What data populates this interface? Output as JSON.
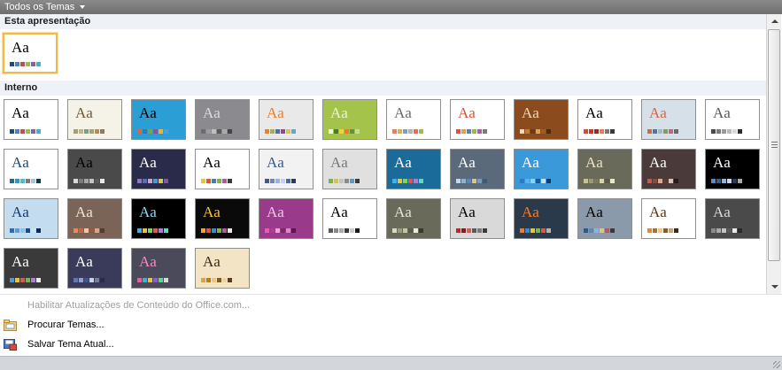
{
  "header": {
    "title": "Todos os Temas"
  },
  "sections": {
    "current": {
      "label": "Esta apresentação"
    },
    "builtin": {
      "label": "Interno"
    }
  },
  "sample_text": "Aa",
  "themes": {
    "current": [
      {
        "bg": "#ffffff",
        "fg": "#000000",
        "sw": [
          "#1f497d",
          "#4f81bd",
          "#c0504d",
          "#9bbb59",
          "#8064a2",
          "#4bacc6"
        ]
      }
    ],
    "builtin": [
      {
        "bg": "#ffffff",
        "fg": "#000000",
        "sw": [
          "#1f497d",
          "#4f81bd",
          "#c0504d",
          "#9bbb59",
          "#8064a2",
          "#4bacc6"
        ]
      },
      {
        "bg": "#f5f2e8",
        "fg": "#6b5a3a",
        "sw": [
          "#a79f72",
          "#c4b48a",
          "#7c9f86",
          "#9fa56e",
          "#b58c58",
          "#8c7c5c"
        ]
      },
      {
        "bg": "#2c9ed6",
        "fg": "#000000",
        "sw": [
          "#e6632e",
          "#2a7cc0",
          "#7aa63d",
          "#9b4a9e",
          "#f2b134",
          "#4a9fd9"
        ]
      },
      {
        "bg": "#8a8a8f",
        "fg": "#dcdcdc",
        "sw": [
          "#6d6d6d",
          "#9c9c9c",
          "#c0c0c0",
          "#5a5a5a",
          "#aaaaaa",
          "#444444"
        ]
      },
      {
        "bg": "#e9e9e9",
        "fg": "#e4822f",
        "sw": [
          "#e4822f",
          "#9fb35a",
          "#4f6ea8",
          "#8c4b8c",
          "#d6c25a",
          "#6aa3c4"
        ]
      },
      {
        "bg": "#a4c34a",
        "fg": "#ecf4d2",
        "sw": [
          "#ecf4d2",
          "#4b7a2a",
          "#ffcc33",
          "#eb7b2a",
          "#6a8f3c",
          "#c5dc8a"
        ]
      },
      {
        "bg": "#ffffff",
        "fg": "#6a6a6a",
        "sw": [
          "#e8805a",
          "#d9b24c",
          "#7d9fc4",
          "#b4b4b4",
          "#e06f4a",
          "#9bbb59"
        ]
      },
      {
        "bg": "#ffffff",
        "fg": "#d9553a",
        "sw": [
          "#d9553a",
          "#e59b59",
          "#5a7fb0",
          "#9fb357",
          "#b25aa0",
          "#7a7a7a"
        ]
      },
      {
        "bg": "#8c4b1c",
        "fg": "#f0d8b0",
        "sw": [
          "#f0d8b0",
          "#c27c3a",
          "#6a3a1a",
          "#d9a35a",
          "#a05a2a",
          "#4a2a10"
        ]
      },
      {
        "bg": "#ffffff",
        "fg": "#000000",
        "sw": [
          "#d84a2a",
          "#c43a1c",
          "#9a2a1a",
          "#e97a5a",
          "#7a7a7a",
          "#3a3a3a"
        ]
      },
      {
        "bg": "#d6e0e8",
        "fg": "#cc6b4c",
        "sw": [
          "#cc6b4c",
          "#4a7a9a",
          "#a4b8c8",
          "#8a9a5a",
          "#b56a8a",
          "#6a6a6a"
        ]
      },
      {
        "bg": "#ffffff",
        "fg": "#5a5a5a",
        "sw": [
          "#4a4a4a",
          "#7a7a7a",
          "#9a9a9a",
          "#bababa",
          "#dadada",
          "#2a2a2a"
        ]
      },
      {
        "bg": "#ffffff",
        "fg": "#2a4a6a",
        "sw": [
          "#1f6a8a",
          "#2a9ac4",
          "#4abad9",
          "#7a7a7a",
          "#a4c4d8",
          "#0a3a5a"
        ]
      },
      {
        "bg": "#4a4a4a",
        "fg": "#000000",
        "sw": [
          "#d9d9d9",
          "#7a7a7a",
          "#a4a4a4",
          "#c4c4c4",
          "#5a5a5a",
          "#eaeaea"
        ]
      },
      {
        "bg": "#2a2a4a",
        "fg": "#ffffff",
        "sw": [
          "#8a7ac4",
          "#5a6ab4",
          "#c4a4d9",
          "#4a9ac4",
          "#d9c45a",
          "#7a5aa4"
        ]
      },
      {
        "bg": "#ffffff",
        "fg": "#000000",
        "sw": [
          "#e8c43a",
          "#d9553a",
          "#4a7ab4",
          "#7ab44a",
          "#b45a9a",
          "#3a3a3a"
        ]
      },
      {
        "bg": "#f2f2f2",
        "fg": "#3a5a8a",
        "sw": [
          "#3a5a8a",
          "#6a8ab4",
          "#9ab4d9",
          "#c4d4e8",
          "#4a6a9a",
          "#2a3a5a"
        ]
      },
      {
        "bg": "#e0e0e0",
        "fg": "#7a7a7a",
        "sw": [
          "#7ab44a",
          "#d9c44a",
          "#c4c4c4",
          "#8a8a8a",
          "#5a9ac4",
          "#3a3a3a"
        ]
      },
      {
        "bg": "#1a6a9a",
        "fg": "#ffffff",
        "sw": [
          "#3ab4e8",
          "#e8c43a",
          "#7ad94a",
          "#d95a4a",
          "#b47ad9",
          "#5ad9c4"
        ]
      },
      {
        "bg": "#5a6a7a",
        "fg": "#ffffff",
        "sw": [
          "#c4d9e8",
          "#8ab4d9",
          "#5a8ab4",
          "#d9c48a",
          "#7a9ab4",
          "#3a5a7a"
        ]
      },
      {
        "bg": "#3a9ad9",
        "fg": "#ffffff",
        "sw": [
          "#2a7ac4",
          "#5ab4e8",
          "#8ad4f2",
          "#1a5a9a",
          "#c4e4f2",
          "#0a3a6a"
        ]
      },
      {
        "bg": "#6a6a5a",
        "fg": "#e8e4c4",
        "sw": [
          "#c4c48a",
          "#9a9a6a",
          "#7a7a5a",
          "#d9d4a4",
          "#5a5a4a",
          "#eaeaca"
        ]
      },
      {
        "bg": "#4a3a3a",
        "fg": "#ffffff",
        "sw": [
          "#c45a4a",
          "#8a4a3a",
          "#e8a48a",
          "#5a3a2a",
          "#d9c4b4",
          "#2a1a1a"
        ]
      },
      {
        "bg": "#000000",
        "fg": "#ffffff",
        "sw": [
          "#5a8ac4",
          "#3a5a8a",
          "#8ab4e8",
          "#c4d9f2",
          "#2a3a5a",
          "#aaaaaa"
        ]
      },
      {
        "bg": "#c4dcf0",
        "fg": "#1a3a6a",
        "sw": [
          "#2a6ab4",
          "#5a9ad9",
          "#8ac4e8",
          "#1a4a8a",
          "#c4e4f8",
          "#0a2a5a"
        ]
      },
      {
        "bg": "#7a6458",
        "fg": "#f0e4d8",
        "sw": [
          "#e88a5a",
          "#c46a3a",
          "#f0c4a4",
          "#9a5a3a",
          "#d9a48a",
          "#5a3a2a"
        ]
      },
      {
        "bg": "#000000",
        "fg": "#8ad9f2",
        "sw": [
          "#3ab4e8",
          "#e8c43a",
          "#7ad94a",
          "#d95a4a",
          "#b47ad9",
          "#5ad9c4"
        ]
      },
      {
        "bg": "#0a0a0a",
        "fg": "#f2c43a",
        "sw": [
          "#f2a43a",
          "#d9553a",
          "#3a8ac4",
          "#7ab44a",
          "#b45a9a",
          "#e8e8e8"
        ]
      },
      {
        "bg": "#9a3a8a",
        "fg": "#f2c4e8",
        "sw": [
          "#e85ab4",
          "#b43a9a",
          "#f2a4d9",
          "#7a2a6a",
          "#d98ac4",
          "#5a1a4a"
        ]
      },
      {
        "bg": "#ffffff",
        "fg": "#000000",
        "sw": [
          "#5a5a5a",
          "#8a8a8a",
          "#aaaaaa",
          "#3a3a3a",
          "#cacaca",
          "#1a1a1a"
        ]
      },
      {
        "bg": "#6a6a5a",
        "fg": "#e4e4d4",
        "sw": [
          "#d9d9c4",
          "#9a9a7a",
          "#c4c4a4",
          "#5a5a4a",
          "#eaeada",
          "#3a3a2a"
        ]
      },
      {
        "bg": "#d9d9d9",
        "fg": "#000000",
        "sw": [
          "#b42a2a",
          "#8a1a1a",
          "#d95a5a",
          "#5a5a5a",
          "#7a7a7a",
          "#3a3a3a"
        ]
      },
      {
        "bg": "#2a3a4a",
        "fg": "#f27a2a",
        "sw": [
          "#f27a2a",
          "#3a8ac4",
          "#e8c43a",
          "#7ab44a",
          "#d95a4a",
          "#b4b4b4"
        ]
      },
      {
        "bg": "#8a9aaa",
        "fg": "#000000",
        "sw": [
          "#2a5a8a",
          "#5a8ab4",
          "#8ab4d9",
          "#d9c48a",
          "#b45a5a",
          "#3a3a3a"
        ]
      },
      {
        "bg": "#ffffff",
        "fg": "#5a3a1a",
        "sw": [
          "#d98a3a",
          "#b46a2a",
          "#f2c48a",
          "#8a5a2a",
          "#c4a47a",
          "#3a2a1a"
        ]
      },
      {
        "bg": "#4a4a4a",
        "fg": "#d9d9d9",
        "sw": [
          "#8a8a8a",
          "#aaaaaa",
          "#c4c4c4",
          "#5a5a5a",
          "#eaeaea",
          "#2a2a2a"
        ]
      },
      {
        "bg": "#3a3a3a",
        "fg": "#ffffff",
        "sw": [
          "#4a9ad9",
          "#e8c43a",
          "#d95a4a",
          "#7ab44a",
          "#b47ad9",
          "#eaeaea"
        ]
      },
      {
        "bg": "#3a3a5a",
        "fg": "#ffffff",
        "sw": [
          "#5a7ab4",
          "#8aa4d9",
          "#3a5a8a",
          "#c4d4e8",
          "#7a7a9a",
          "#2a2a4a"
        ]
      },
      {
        "bg": "#4a4a5a",
        "fg": "#f28ac4",
        "sw": [
          "#f25a9a",
          "#3ab4c4",
          "#e8c43a",
          "#8a5ad9",
          "#5ad98a",
          "#d9d9d9"
        ]
      },
      {
        "bg": "#f2e4c4",
        "fg": "#3a2a1a",
        "sw": [
          "#d9a44a",
          "#b47a2a",
          "#f2c47a",
          "#8a5a1a",
          "#e8d4a4",
          "#5a3a1a"
        ]
      }
    ]
  },
  "menu": {
    "enable_updates": "Habilitar Atualizações de Conteúdo do Office.com...",
    "browse": "Procurar Temas...",
    "save": "Salvar Tema Atual..."
  }
}
